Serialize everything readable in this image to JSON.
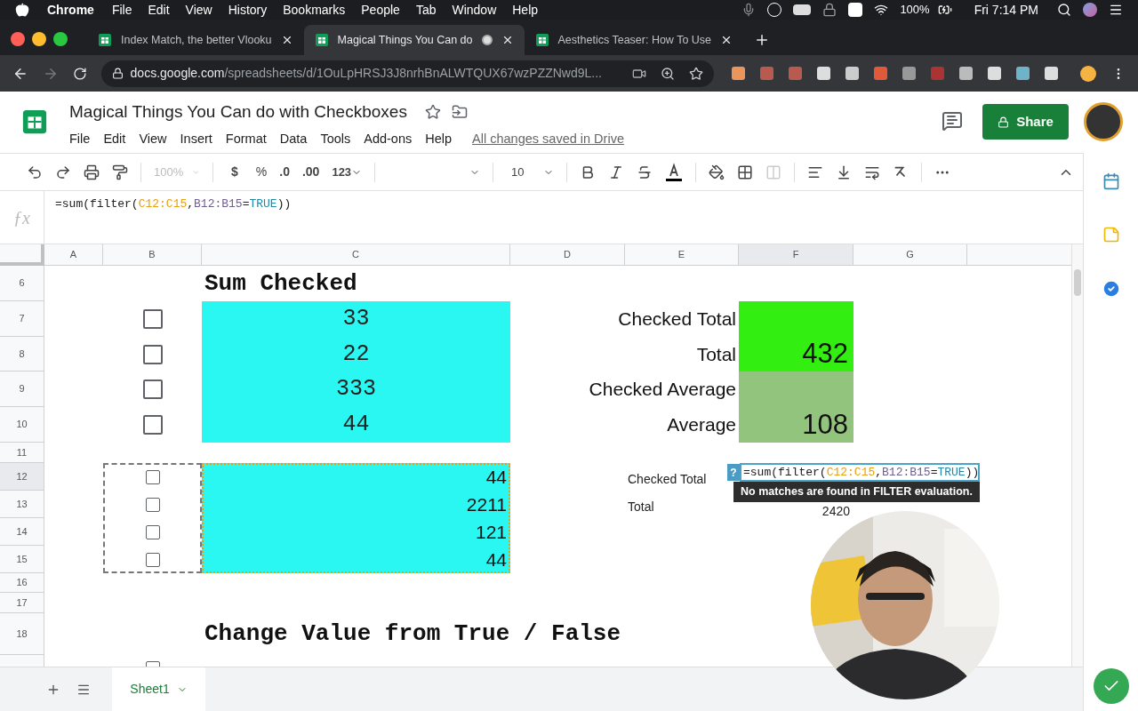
{
  "menu_bar": {
    "app": "Chrome",
    "items": [
      "File",
      "Edit",
      "View",
      "History",
      "Bookmarks",
      "People",
      "Tab",
      "Window",
      "Help"
    ],
    "battery": "100%",
    "clock": "Fri 7:14 PM"
  },
  "browser": {
    "tabs": [
      {
        "title": "Index Match, the better Vlooku",
        "selected": false,
        "loading": false
      },
      {
        "title": "Magical Things You Can do",
        "selected": true,
        "loading": true
      },
      {
        "title": "Aesthetics Teaser: How To Use",
        "selected": false,
        "loading": false
      }
    ],
    "url_host": "docs.google.com",
    "url_path": "/spreadsheets/d/1OuLpHRSJ3J8nrhBnALWTQUX67wzPZZNwd9L..."
  },
  "doc": {
    "title": "Magical Things You Can do with Checkboxes",
    "menus": [
      "File",
      "Edit",
      "View",
      "Insert",
      "Format",
      "Data",
      "Tools",
      "Add-ons",
      "Help"
    ],
    "save_status": "All changes saved in Drive",
    "share": "Share"
  },
  "toolbar": {
    "zoom": "100%",
    "currency": "$",
    "percent": "%",
    "decrease_decimals": ".0",
    "increase_decimals": ".00",
    "number_format": "123",
    "font_size": "10"
  },
  "formula_bar": {
    "icon": "ƒx",
    "parts": [
      {
        "text": "=sum(filter("
      },
      {
        "text": "C12:C15",
        "color": "#e8a010"
      },
      {
        "text": ","
      },
      {
        "text": "B12:B15",
        "color": "#6f5f8f"
      },
      {
        "text": "="
      },
      {
        "text": "TRUE",
        "color": "#1c8aa8"
      },
      {
        "text": "))"
      }
    ]
  },
  "sheet": {
    "columns": [
      {
        "label": "A",
        "selected": false
      },
      {
        "label": "B",
        "selected": false
      },
      {
        "label": "C",
        "selected": false
      },
      {
        "label": "D",
        "selected": false
      },
      {
        "label": "E",
        "selected": false
      },
      {
        "label": "F",
        "selected": true
      },
      {
        "label": "G",
        "selected": false
      }
    ],
    "rows": [
      {
        "number": "6",
        "selected": false,
        "cells": {
          "C": {
            "kind": "heading",
            "text": "Sum Checked"
          }
        }
      },
      {
        "number": "7",
        "selected": false,
        "cells": {
          "B": {
            "kind": "checkbox",
            "checked": false
          },
          "C": {
            "kind": "value",
            "text": "33",
            "color": "#2af7f2"
          },
          "E": {
            "kind": "label",
            "text": "Checked Total"
          },
          "F": {
            "kind": "total",
            "color": "#33ee11"
          }
        }
      },
      {
        "number": "8",
        "selected": false,
        "cells": {
          "B": {
            "kind": "checkbox",
            "checked": false
          },
          "C": {
            "kind": "value",
            "text": "22",
            "color": "#2af7f2"
          },
          "E": {
            "kind": "label",
            "text": "Total"
          },
          "F": {
            "kind": "total",
            "text": "432",
            "color": "#33ee11"
          }
        }
      },
      {
        "number": "9",
        "selected": false,
        "cells": {
          "B": {
            "kind": "checkbox",
            "checked": false
          },
          "C": {
            "kind": "value",
            "text": "333",
            "color": "#2af7f2"
          },
          "E": {
            "kind": "label",
            "text": "Checked Average"
          },
          "F": {
            "kind": "total",
            "color": "#93c47d"
          }
        }
      },
      {
        "number": "10",
        "selected": false,
        "cells": {
          "B": {
            "kind": "checkbox",
            "checked": false
          },
          "C": {
            "kind": "value",
            "text": "44",
            "color": "#2af7f2"
          },
          "E": {
            "kind": "label",
            "text": "Average"
          },
          "F": {
            "kind": "total",
            "text": "108",
            "color": "#93c47d"
          }
        }
      },
      {
        "number": "11",
        "selected": false,
        "cells": {}
      },
      {
        "number": "12",
        "selected": true,
        "cells": {
          "B": {
            "kind": "checkbox",
            "checked": false
          },
          "C": {
            "kind": "value",
            "text": "44",
            "color": "#2af7f2"
          },
          "E": {
            "kind": "label",
            "text": "Checked Total"
          },
          "F": {
            "kind": "editor",
            "badge": "?",
            "tooltip": "No matches are found in FILTER evaluation.",
            "parts": [
              {
                "text": "=sum(filter("
              },
              {
                "text": "C12:C15",
                "color": "#e8a010"
              },
              {
                "text": ","
              },
              {
                "text": "B12:B15",
                "color": "#6f5f8f"
              },
              {
                "text": "="
              },
              {
                "text": "TRUE",
                "color": "#1c8aa8"
              },
              {
                "text": "))"
              }
            ]
          }
        }
      },
      {
        "number": "13",
        "selected": false,
        "cells": {
          "B": {
            "kind": "checkbox",
            "checked": false
          },
          "C": {
            "kind": "value",
            "text": "2211",
            "color": "#2af7f2"
          },
          "E": {
            "kind": "label",
            "text": "Total"
          },
          "F": {
            "kind": "total",
            "text": "2420"
          }
        }
      },
      {
        "number": "14",
        "selected": false,
        "cells": {
          "B": {
            "kind": "checkbox",
            "checked": false
          },
          "C": {
            "kind": "value",
            "text": "121",
            "color": "#2af7f2"
          }
        }
      },
      {
        "number": "15",
        "selected": false,
        "cells": {
          "B": {
            "kind": "checkbox",
            "checked": false
          },
          "C": {
            "kind": "value",
            "text": "44",
            "color": "#2af7f2"
          }
        }
      },
      {
        "number": "16",
        "selected": false,
        "cells": {}
      },
      {
        "number": "17",
        "selected": false,
        "cells": {}
      },
      {
        "number": "18",
        "selected": false,
        "cells": {
          "C": {
            "kind": "heading",
            "text": "Change Value from True / False"
          }
        }
      },
      {
        "cells": {
          "B": {
            "kind": "checkbox",
            "checked": false
          }
        }
      }
    ]
  },
  "sheet_tabs": [
    {
      "label": "Sheet1",
      "selected": true
    }
  ]
}
